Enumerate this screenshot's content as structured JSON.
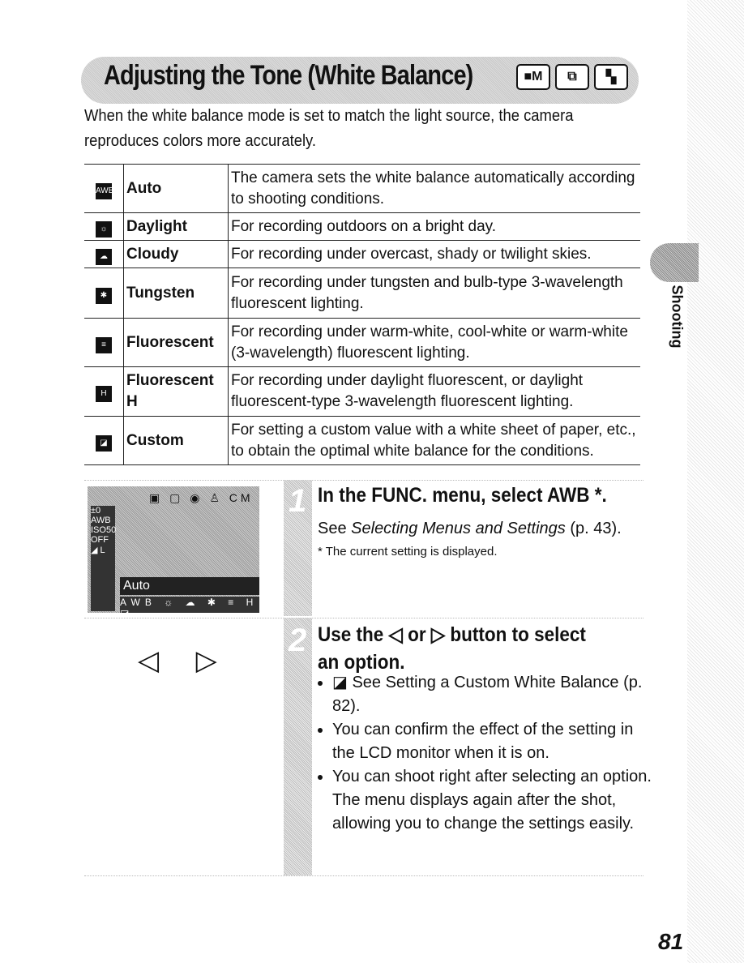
{
  "title": "Adjusting the Tone (White Balance)",
  "mode_icons": [
    "camera-manual-icon",
    "stitch-assist-icon",
    "movie-icon"
  ],
  "intro": "When the white balance mode is set to match the light source, the camera reproduces colors more accurately.",
  "table": [
    {
      "icon": "AWB",
      "name": "Auto",
      "desc": "The camera sets the white balance automatically according to shooting conditions."
    },
    {
      "icon": "☼",
      "name": "Daylight",
      "desc": "For recording outdoors on a bright day."
    },
    {
      "icon": "☁",
      "name": "Cloudy",
      "desc": "For recording under overcast, shady or twilight skies."
    },
    {
      "icon": "✱",
      "name": "Tungsten",
      "desc": "For recording under tungsten and bulb-type 3-wavelength fluorescent lighting."
    },
    {
      "icon": "≡",
      "name": "Fluorescent",
      "desc": "For recording under warm-white, cool-white or warm-white (3-wavelength) fluorescent lighting."
    },
    {
      "icon": "H",
      "name": "Fluorescent H",
      "desc": "For recording under daylight fluorescent, or daylight fluorescent-type 3-wavelength fluorescent lighting."
    },
    {
      "icon": "◪",
      "name": "Custom",
      "desc": "For setting a custom value with a white sheet of paper, etc., to obtain the optimal white balance for the conditions."
    }
  ],
  "lcd": {
    "label": "Auto",
    "left": "±0 AWB ISO50 OFF ◢ L",
    "options": "AWB ☼ ☁ ✱ ≡ H ◪",
    "top": "▣ ▢  ◉ ♙ CM"
  },
  "step1": {
    "num": "1",
    "title": "In the FUNC. menu, select AWB *.",
    "text_prefix": "See ",
    "link": "Selecting Menus and Settings",
    "text_suffix": " (p. 43).",
    "note": "* The current setting is displayed."
  },
  "step2": {
    "num": "2",
    "title": "Use the ◁ or ▷ button to select an option.",
    "bullets": [
      "◪ See Setting a Custom White Balance (p. 82).",
      "You can confirm the effect of the setting in the LCD monitor when it is on.",
      "You can shoot right after selecting an option. The menu displays again after the shot, allowing you to change the settings easily."
    ]
  },
  "dial": "◁ ▷",
  "side_tab": "Shooting",
  "page_number": "81"
}
